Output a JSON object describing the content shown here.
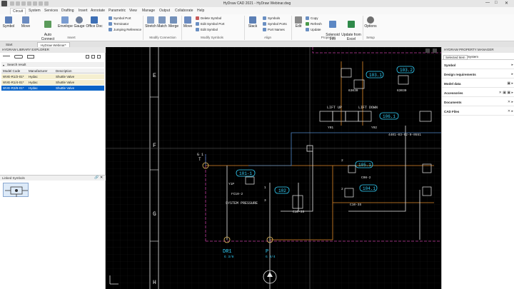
{
  "app": {
    "title": "HyDraw CAD 2021 - HyDraw Webinar.dwg",
    "window_controls": [
      "—",
      "□",
      "✕"
    ]
  },
  "ribbon_tabs": [
    "Circuit",
    "System",
    "Services",
    "Drafting",
    "Insert",
    "Annotate",
    "Parametric",
    "View",
    "Manage",
    "Output",
    "Collaborate",
    "Help"
  ],
  "ribbon": {
    "buttons": {
      "symbol": "Symbol",
      "move": "Move",
      "auto_connect": "Auto\nConnect",
      "envelope": "Envelope",
      "gauge": "Gauge",
      "office_doc": "Office Doc",
      "symbol_port": "Symbol Port",
      "terminator": "Terminator",
      "jumping_reference": "Jumping Reference",
      "stretch": "Stretch",
      "match": "Match",
      "merge": "Merge",
      "move2": "Move",
      "delete_symbol": "Delete Symbol",
      "edit_symbol_port": "Edit Symbol Port",
      "edit_symbol": "Edit Symbol",
      "stack": "Stack",
      "symbols": "Symbols",
      "symbol_ports": "Symbol Ports",
      "port_names": "Port Names",
      "edit": "Edit",
      "copy": "Copy",
      "refresh": "Refresh",
      "update": "Update",
      "solenoid_info": "Solenoid\nInfo",
      "update_from_excel": "Update from\nExcel",
      "options": "Options"
    },
    "groups": {
      "insert": "Insert",
      "modify_connection": "Modify Connection",
      "modify_symbols": "Modify Symbols",
      "align": "Align",
      "properties": "Properties",
      "setup": "Setup"
    }
  },
  "doc_tabs": [
    "Start",
    "HyDraw Webinar*"
  ],
  "library_explorer": {
    "title": "HYDRAW LIBRARY EXPLORER",
    "search_label": "Search result",
    "columns": [
      "Model Code",
      "Manufacturer",
      "Description"
    ],
    "rows": [
      {
        "code": "WVE-R1/2-01*",
        "mfr": "Hydac",
        "desc": "Shuttle Valve",
        "state": "alt"
      },
      {
        "code": "WVE-R1/4-01*",
        "mfr": "Hydac",
        "desc": "Shuttle Valve",
        "state": "alt"
      },
      {
        "code": "WVE-R3/8-01*",
        "mfr": "Hydac",
        "desc": "Shuttle Valve",
        "state": "selected"
      }
    ]
  },
  "linked_symbols": {
    "title": "Linked Symbols"
  },
  "property_manager": {
    "title": "HYDRAW PROPERTY MANAGER",
    "tabs": [
      "Selected Item",
      "System"
    ],
    "rows": [
      "Symbol",
      "Design requirements",
      "Model data",
      "Accessories",
      "Documents",
      "CAD Files"
    ]
  },
  "drawing": {
    "row_letters": [
      "E",
      "F",
      "G",
      "H"
    ],
    "labels": {
      "t1": "103.1",
      "t2": "103.2",
      "t3": "106.1",
      "t4": "105.1",
      "t5": "104.1",
      "t6": "101-1",
      "t7": "102",
      "port_g1": "G 1",
      "port_t": "T",
      "lift_up": "LIFT UP",
      "lift_down": "LIFT DOWN",
      "y01": "Y01",
      "y02": "Y02",
      "part_4401": "4401-03-02-0-0551",
      "code_63030a": "63030",
      "code_63030b": "63030",
      "ypp": "Y1P",
      "fc10": "FC10-2",
      "sys_press": "SYSTEM PRESSURE",
      "c10_3s_a": "C10-3S",
      "c10_3s_b": "C10-3S",
      "c08_2": "C08-2",
      "dr1": "DR1",
      "dr1_size": "G 3/8",
      "p": "P",
      "p_size": "G 3/4",
      "n1": "1",
      "n2": "2",
      "n3": "3"
    }
  },
  "colors": {
    "canvas_bg": "#000000",
    "label_cyan": "#33d4ff",
    "wire_orange": "#e08a2a",
    "wire_blue": "#4f86c6",
    "line_white": "#e8e8e8",
    "dash_magenta": "#c03aa0",
    "selected_row": "#0a64c8",
    "alt_row": "#f5efd0"
  }
}
